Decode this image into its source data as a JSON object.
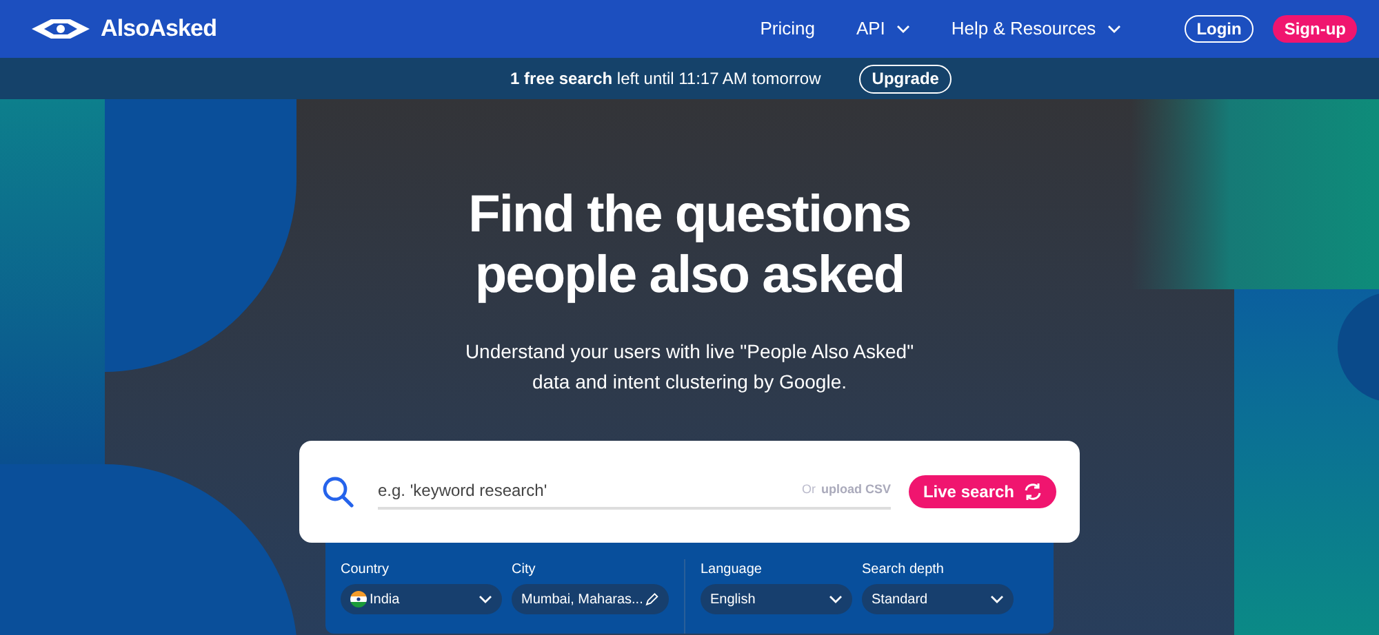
{
  "brand": {
    "name": "AlsoAsked"
  },
  "nav": [
    {
      "label": "Pricing",
      "dropdown": false
    },
    {
      "label": "API",
      "dropdown": true
    },
    {
      "label": "Help & Resources",
      "dropdown": true
    }
  ],
  "auth_buttons": [
    {
      "label": "Login",
      "kind": "outline"
    },
    {
      "label": "Sign-up",
      "kind": "filled"
    }
  ],
  "banner": {
    "text": "**1 free search** left until 11:17 AM tomorrow",
    "button": "Upgrade"
  },
  "hero": {
    "title_lines": [
      "Find the questions",
      "people also asked"
    ],
    "subtitle_lines": [
      "Understand your users with live \"People Also Asked\"",
      "data and intent clustering by Google."
    ]
  },
  "search": {
    "placeholder": "e.g. 'keyword research'",
    "or_text": "Or",
    "upload_link": "upload CSV",
    "button": "Live search"
  },
  "filters": [
    {
      "label": "Country",
      "value": "India",
      "kind": "flag-select"
    },
    {
      "label": "City",
      "value": "Mumbai, Maharas...",
      "kind": "editable"
    },
    {
      "label": "Language",
      "value": "English",
      "kind": "select"
    },
    {
      "label": "Search depth",
      "value": "Standard",
      "kind": "select"
    }
  ]
}
